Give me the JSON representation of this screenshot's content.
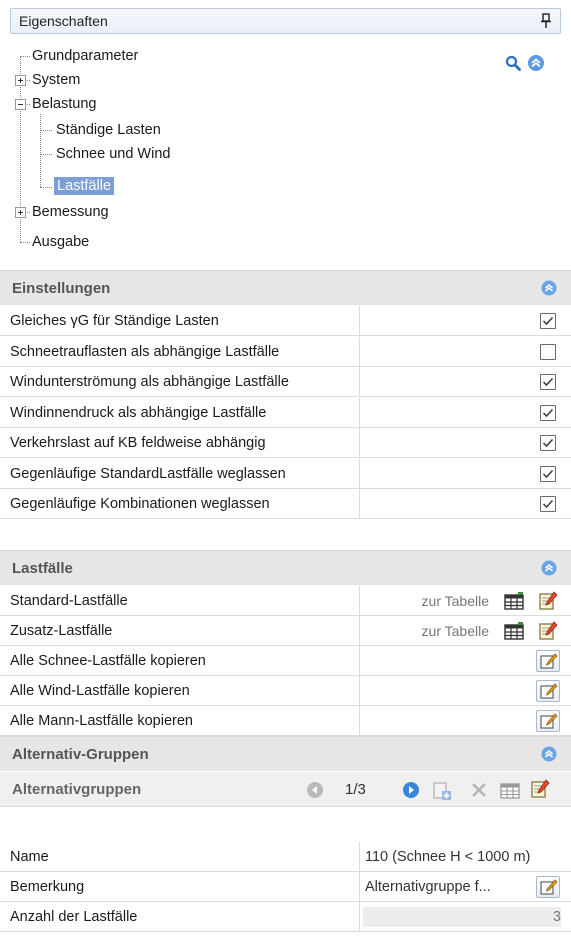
{
  "panel": {
    "title": "Eigenschaften"
  },
  "tree": {
    "items": [
      {
        "label": "Grundparameter"
      },
      {
        "label": "System"
      },
      {
        "label": "Belastung"
      },
      {
        "label": "Ständige Lasten"
      },
      {
        "label": "Schnee und Wind"
      },
      {
        "label": "Lastfälle"
      },
      {
        "label": "Bemessung"
      },
      {
        "label": "Ausgabe"
      }
    ]
  },
  "einstellungen": {
    "title": "Einstellungen",
    "rows": [
      {
        "label": "Gleiches γG für Ständige Lasten",
        "checked": true
      },
      {
        "label": "Schneetrauflasten als abhängige Lastfälle",
        "checked": false
      },
      {
        "label": "Windunterströmung als abhängige Lastfälle",
        "checked": true
      },
      {
        "label": "Windinnendruck als abhängige Lastfälle",
        "checked": true
      },
      {
        "label": "Verkehrslast auf KB feldweise abhängig",
        "checked": true
      },
      {
        "label": "Gegenläufige StandardLastfälle weglassen",
        "checked": true
      },
      {
        "label": "Gegenläufige Kombinationen weglassen",
        "checked": true
      }
    ]
  },
  "lastfaelle": {
    "title": "Lastfälle",
    "rows": [
      {
        "label": "Standard-Lastfälle",
        "link": "zur Tabelle"
      },
      {
        "label": "Zusatz-Lastfälle",
        "link": "zur Tabelle"
      },
      {
        "label": "Alle Schnee-Lastfälle kopieren"
      },
      {
        "label": "Alle Wind-Lastfälle kopieren"
      },
      {
        "label": "Alle Mann-Lastfälle kopieren"
      }
    ]
  },
  "alternativ": {
    "title": "Alternativ-Gruppen",
    "nav_title": "Alternativgruppen",
    "counter": "1/3",
    "rows": [
      {
        "label": "Name",
        "value": "110 (Schnee H < 1000 m)"
      },
      {
        "label": "Bemerkung",
        "value": "Alternativgruppe f..."
      },
      {
        "label": "Anzahl der Lastfälle",
        "value": "3"
      }
    ]
  },
  "icons": {
    "pin": "pin-icon",
    "search": "search-icon",
    "collapse": "collapse-up-icon",
    "table": "table-icon",
    "edit": "edit-icon",
    "prev": "prev-icon",
    "next": "next-icon",
    "add": "add-icon",
    "delete": "delete-icon",
    "grid": "grid-icon"
  },
  "colors": {
    "selection": "#7d9fd6",
    "section_bg": "#e6e6e6",
    "accent": "#4a8ad8"
  }
}
